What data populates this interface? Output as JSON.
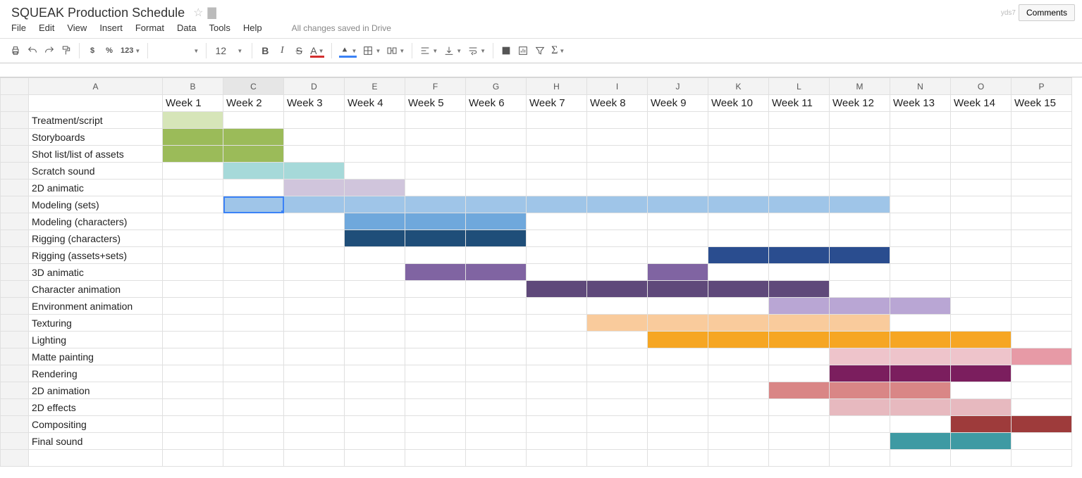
{
  "doc": {
    "title": "SQUEAK Production Schedule",
    "comments_label": "Comments",
    "user_id_fragment": "yds7",
    "drive_status": "All changes saved in Drive"
  },
  "menu": {
    "items": [
      "File",
      "Edit",
      "View",
      "Insert",
      "Format",
      "Data",
      "Tools",
      "Help"
    ]
  },
  "toolbar": {
    "currency": "$",
    "percent": "%",
    "num_format": "123",
    "font_size": "12",
    "bold": "B",
    "italic": "I",
    "strike": "S",
    "underline_a": "A"
  },
  "columns": [
    "",
    "A",
    "B",
    "C",
    "D",
    "E",
    "F",
    "G",
    "H",
    "I",
    "J",
    "K",
    "L",
    "M",
    "N",
    "O",
    "P"
  ],
  "selected_cell": {
    "row": 6,
    "col": 2
  },
  "header_row": [
    "",
    "Week 1",
    "Week 2",
    "Week 3",
    "Week 4",
    "Week 5",
    "Week 6",
    "Week 7",
    "Week 8",
    "Week 9",
    "Week 10",
    "Week 11",
    "Week 12",
    "Week 13",
    "Week 14",
    "Week 15"
  ],
  "tasks": [
    {
      "name": "Treatment/script",
      "cells": [
        {
          "col": 1,
          "color": "#d6e5b8"
        }
      ]
    },
    {
      "name": "Storyboards",
      "cells": [
        {
          "col": 1,
          "color": "#9bbb59"
        },
        {
          "col": 2,
          "color": "#9bbb59"
        }
      ]
    },
    {
      "name": "Shot list/list of assets",
      "cells": [
        {
          "col": 1,
          "color": "#9bbb59"
        },
        {
          "col": 2,
          "color": "#9bbb59"
        }
      ]
    },
    {
      "name": "Scratch sound",
      "cells": [
        {
          "col": 2,
          "color": "#a6d9d9"
        },
        {
          "col": 3,
          "color": "#a6d9d9"
        }
      ]
    },
    {
      "name": "2D animatic",
      "cells": [
        {
          "col": 3,
          "color": "#d0c5dc"
        },
        {
          "col": 4,
          "color": "#d0c5dc"
        }
      ]
    },
    {
      "name": "Modeling (sets)",
      "cells": [
        {
          "col": 2,
          "color": "#9fc5e8"
        },
        {
          "col": 3,
          "color": "#9fc5e8"
        },
        {
          "col": 4,
          "color": "#9fc5e8"
        },
        {
          "col": 5,
          "color": "#9fc5e8"
        },
        {
          "col": 6,
          "color": "#9fc5e8"
        },
        {
          "col": 7,
          "color": "#9fc5e8"
        },
        {
          "col": 8,
          "color": "#9fc5e8"
        },
        {
          "col": 9,
          "color": "#9fc5e8"
        },
        {
          "col": 10,
          "color": "#9fc5e8"
        },
        {
          "col": 11,
          "color": "#9fc5e8"
        },
        {
          "col": 12,
          "color": "#9fc5e8"
        }
      ]
    },
    {
      "name": "Modeling (characters)",
      "cells": [
        {
          "col": 4,
          "color": "#6fa8dc"
        },
        {
          "col": 5,
          "color": "#6fa8dc"
        },
        {
          "col": 6,
          "color": "#6fa8dc"
        }
      ]
    },
    {
      "name": "Rigging (characters)",
      "cells": [
        {
          "col": 4,
          "color": "#1f4e79"
        },
        {
          "col": 5,
          "color": "#1f4e79"
        },
        {
          "col": 6,
          "color": "#1f4e79"
        }
      ]
    },
    {
      "name": "Rigging (assets+sets)",
      "cells": [
        {
          "col": 10,
          "color": "#2a4d8f"
        },
        {
          "col": 11,
          "color": "#2a4d8f"
        },
        {
          "col": 12,
          "color": "#2a4d8f"
        }
      ]
    },
    {
      "name": "3D animatic",
      "cells": [
        {
          "col": 5,
          "color": "#8064a2"
        },
        {
          "col": 6,
          "color": "#8064a2"
        },
        {
          "col": 9,
          "color": "#8064a2"
        }
      ]
    },
    {
      "name": "Character animation",
      "cells": [
        {
          "col": 7,
          "color": "#5f497a"
        },
        {
          "col": 8,
          "color": "#5f497a"
        },
        {
          "col": 9,
          "color": "#5f497a"
        },
        {
          "col": 10,
          "color": "#5f497a"
        },
        {
          "col": 11,
          "color": "#5f497a"
        }
      ]
    },
    {
      "name": "Environment animation",
      "cells": [
        {
          "col": 11,
          "color": "#b9a6d4"
        },
        {
          "col": 12,
          "color": "#b9a6d4"
        },
        {
          "col": 13,
          "color": "#b9a6d4"
        }
      ]
    },
    {
      "name": "Texturing",
      "cells": [
        {
          "col": 8,
          "color": "#f9cb9c"
        },
        {
          "col": 9,
          "color": "#f9cb9c"
        },
        {
          "col": 10,
          "color": "#f9cb9c"
        },
        {
          "col": 11,
          "color": "#f9cb9c"
        },
        {
          "col": 12,
          "color": "#f9cb9c"
        }
      ]
    },
    {
      "name": "Lighting",
      "cells": [
        {
          "col": 9,
          "color": "#f6a623"
        },
        {
          "col": 10,
          "color": "#f6a623"
        },
        {
          "col": 11,
          "color": "#f6a623"
        },
        {
          "col": 12,
          "color": "#f6a623"
        },
        {
          "col": 13,
          "color": "#f6a623"
        },
        {
          "col": 14,
          "color": "#f6a623"
        }
      ]
    },
    {
      "name": "Matte painting",
      "cells": [
        {
          "col": 12,
          "color": "#eec4cb"
        },
        {
          "col": 13,
          "color": "#eec4cb"
        },
        {
          "col": 14,
          "color": "#eec4cb"
        },
        {
          "col": 15,
          "color": "#e79aa6"
        }
      ]
    },
    {
      "name": "Rendering",
      "cells": [
        {
          "col": 12,
          "color": "#7b1e5e"
        },
        {
          "col": 13,
          "color": "#7b1e5e"
        },
        {
          "col": 14,
          "color": "#7b1e5e"
        }
      ]
    },
    {
      "name": "2D animation",
      "cells": [
        {
          "col": 11,
          "color": "#d98686"
        },
        {
          "col": 12,
          "color": "#d98686"
        },
        {
          "col": 13,
          "color": "#d98686"
        }
      ]
    },
    {
      "name": "2D effects",
      "cells": [
        {
          "col": 12,
          "color": "#e7b9bf"
        },
        {
          "col": 13,
          "color": "#e7b9bf"
        },
        {
          "col": 14,
          "color": "#e7b9bf"
        }
      ]
    },
    {
      "name": "Compositing",
      "cells": [
        {
          "col": 14,
          "color": "#9e3b3b"
        },
        {
          "col": 15,
          "color": "#9e3b3b"
        }
      ]
    },
    {
      "name": "Final sound",
      "cells": [
        {
          "col": 13,
          "color": "#3e9aa3"
        },
        {
          "col": 14,
          "color": "#3e9aa3"
        }
      ]
    }
  ],
  "chart_data": {
    "type": "table",
    "title": "SQUEAK Production Schedule (Gantt)",
    "xlabel": "Week",
    "x": [
      1,
      2,
      3,
      4,
      5,
      6,
      7,
      8,
      9,
      10,
      11,
      12,
      13,
      14,
      15
    ],
    "series": [
      {
        "name": "Treatment/script",
        "start": 1,
        "end": 1
      },
      {
        "name": "Storyboards",
        "start": 1,
        "end": 2
      },
      {
        "name": "Shot list/list of assets",
        "start": 1,
        "end": 2
      },
      {
        "name": "Scratch sound",
        "start": 2,
        "end": 3
      },
      {
        "name": "2D animatic",
        "start": 3,
        "end": 4
      },
      {
        "name": "Modeling (sets)",
        "start": 2,
        "end": 12
      },
      {
        "name": "Modeling (characters)",
        "start": 4,
        "end": 6
      },
      {
        "name": "Rigging (characters)",
        "start": 4,
        "end": 6
      },
      {
        "name": "Rigging (assets+sets)",
        "start": 10,
        "end": 12
      },
      {
        "name": "3D animatic",
        "segments": [
          [
            5,
            6
          ],
          [
            9,
            9
          ]
        ]
      },
      {
        "name": "Character animation",
        "start": 7,
        "end": 11
      },
      {
        "name": "Environment animation",
        "start": 11,
        "end": 13
      },
      {
        "name": "Texturing",
        "start": 8,
        "end": 12
      },
      {
        "name": "Lighting",
        "start": 9,
        "end": 14
      },
      {
        "name": "Matte painting",
        "start": 12,
        "end": 15
      },
      {
        "name": "Rendering",
        "start": 12,
        "end": 14
      },
      {
        "name": "2D animation",
        "start": 11,
        "end": 13
      },
      {
        "name": "2D effects",
        "start": 12,
        "end": 14
      },
      {
        "name": "Compositing",
        "start": 14,
        "end": 15
      },
      {
        "name": "Final sound",
        "start": 13,
        "end": 14
      }
    ]
  }
}
